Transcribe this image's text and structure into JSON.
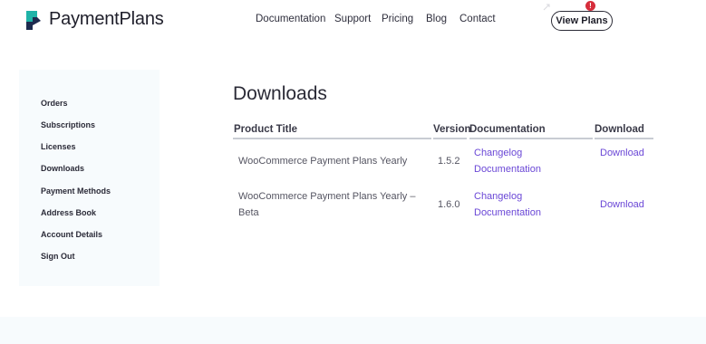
{
  "brand": {
    "name": "PaymentPlans"
  },
  "nav": {
    "items": [
      "Documentation",
      "Support",
      "Pricing",
      "Blog",
      "Contact"
    ],
    "cta_label": "View Plans",
    "notification_count": "!"
  },
  "sidebar": {
    "items": [
      "Orders",
      "Subscriptions",
      "Licenses",
      "Downloads",
      "Payment Methods",
      "Address Book",
      "Account Details",
      "Sign Out"
    ]
  },
  "main": {
    "title": "Downloads",
    "columns": [
      "Product Title",
      "Version",
      "Documentation",
      "Download"
    ],
    "rows": [
      {
        "product_line1": "WooCommerce Payment Plans Yearly",
        "product_line2": "",
        "version": "1.5.2",
        "doc1": "Changelog",
        "doc2": "Documentation",
        "download": "Download"
      },
      {
        "product_line1": "WooCommerce Payment Plans Yearly –",
        "product_line2": "Beta",
        "version": "1.6.0",
        "doc1": "Changelog",
        "doc2": "Documentation",
        "download": "Download"
      }
    ]
  },
  "colors": {
    "accent": "#6a47d6",
    "sidebar_bg": "#f7fbfd",
    "badge": "#d62d3b",
    "logo_teal": "#1fb3a8",
    "logo_dark": "#1d2b4f"
  }
}
